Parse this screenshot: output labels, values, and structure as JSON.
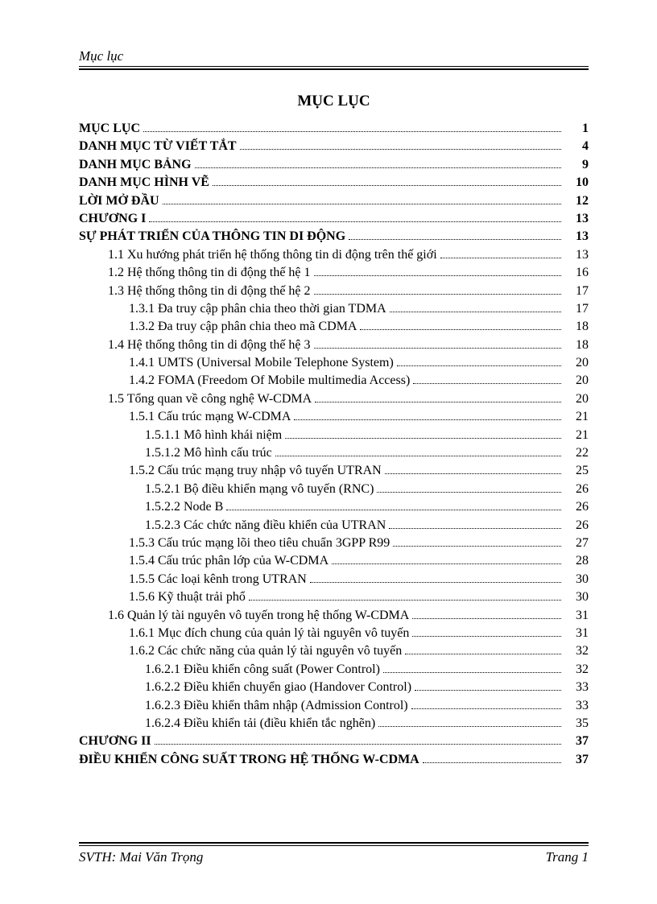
{
  "header": "Mục lục",
  "title": "MỤC LỤC",
  "toc": [
    {
      "level": 0,
      "label": "MỤC LỤC",
      "page": "1"
    },
    {
      "level": 0,
      "label": "DANH MỤC TỪ VIẾT TẮT",
      "page": "4"
    },
    {
      "level": 0,
      "label": "DANH MỤC BẢNG",
      "page": "9"
    },
    {
      "level": 0,
      "label": "DANH MỤC HÌNH VẼ",
      "page": "10"
    },
    {
      "level": 0,
      "label": "LỜI MỞ ĐẦU",
      "page": "12"
    },
    {
      "level": 0,
      "label": "CHƯƠNG I",
      "page": "13"
    },
    {
      "level": 0,
      "label": "SỰ PHÁT TRIỂN CỦA THÔNG TIN DI ĐỘNG",
      "page": "13"
    },
    {
      "level": 1,
      "label": "1.1  Xu hướng phát triển hệ thống thông tin di động trên thế giới",
      "page": "13"
    },
    {
      "level": 1,
      "label": "1.2  Hệ thống thông tin di động thế hệ 1",
      "page": "16"
    },
    {
      "level": 1,
      "label": "1.3  Hệ thống thông tin di động  thế hệ 2",
      "page": "17"
    },
    {
      "level": 2,
      "label": "1.3.1  Đa truy cập phân  chia theo thời gian TDMA",
      "page": "17"
    },
    {
      "level": 2,
      "label": "1.3.2  Đa truy cập phân chia theo mã CDMA",
      "page": "18"
    },
    {
      "level": 1,
      "label": "1.4  Hệ thống thông tin di động thế hệ 3",
      "page": "18"
    },
    {
      "level": 2,
      "label": "1.4.1  UMTS (Universal Mobile Telephone System)",
      "page": "20"
    },
    {
      "level": 2,
      "label": "1.4.2  FOMA (Freedom Of Mobile multimedia Access)",
      "page": "20"
    },
    {
      "level": 1,
      "label": "1.5  Tổng quan về công nghệ W-CDMA",
      "page": "20"
    },
    {
      "level": 2,
      "label": "1.5.1  Cấu trúc mạng W-CDMA",
      "page": "21"
    },
    {
      "level": 3,
      "label": "1.5.1.1  Mô hình khái niệm",
      "page": "21"
    },
    {
      "level": 3,
      "label": "1.5.1.2  Mô hình cấu trúc",
      "page": "22"
    },
    {
      "level": 2,
      "label": "1.5.2  Cấu trúc mạng truy nhập vô tuyến UTRAN",
      "page": "25"
    },
    {
      "level": 3,
      "label": "1.5.2.1  Bộ điều khiển mạng vô tuyến (RNC)",
      "page": "26"
    },
    {
      "level": 3,
      "label": "1.5.2.2  Node B",
      "page": "26"
    },
    {
      "level": 3,
      "label": "1.5.2.3  Các chức năng điều khiển của UTRAN",
      "page": "26"
    },
    {
      "level": 2,
      "label": "1.5.3  Cấu trúc mạng lõi theo tiêu chuẩn 3GPP R99",
      "page": "27"
    },
    {
      "level": 2,
      "label": "1.5.4  Cấu trúc phân lớp của W-CDMA",
      "page": "28"
    },
    {
      "level": 2,
      "label": "1.5.5  Các loại kênh trong UTRAN",
      "page": "30"
    },
    {
      "level": 2,
      "label": "1.5.6  Kỹ thuật trải phổ",
      "page": "30"
    },
    {
      "level": 1,
      "label": "1.6  Quản lý tài nguyên vô tuyến trong hệ thống W-CDMA",
      "page": "31"
    },
    {
      "level": 2,
      "label": "1.6.1  Mục đích chung của quản lý tài nguyên vô tuyến",
      "page": "31"
    },
    {
      "level": 2,
      "label": "1.6.2  Các chức năng của quản lý tài nguyên vô tuyến",
      "page": "32"
    },
    {
      "level": 3,
      "label": "1.6.2.1  Điều khiển công suất (Power Control)",
      "page": "32"
    },
    {
      "level": 3,
      "label": "1.6.2.2  Điều khiển chuyển giao (Handover Control)",
      "page": "33"
    },
    {
      "level": 3,
      "label": "1.6.2.3  Điều khiển thâm nhập (Admission Control)",
      "page": "33"
    },
    {
      "level": 3,
      "label": "1.6.2.4  Điều khiển tải (điều khiển tắc nghẽn)",
      "page": "35"
    },
    {
      "level": 0,
      "label": "CHƯƠNG II",
      "page": "37"
    },
    {
      "level": 0,
      "label": "ĐIỀU KHIỂN CÔNG SUẤT TRONG HỆ THỐNG W-CDMA",
      "page": "37"
    }
  ],
  "footer_left": "SVTH: Mai Văn Trọng",
  "footer_right": "Trang 1"
}
